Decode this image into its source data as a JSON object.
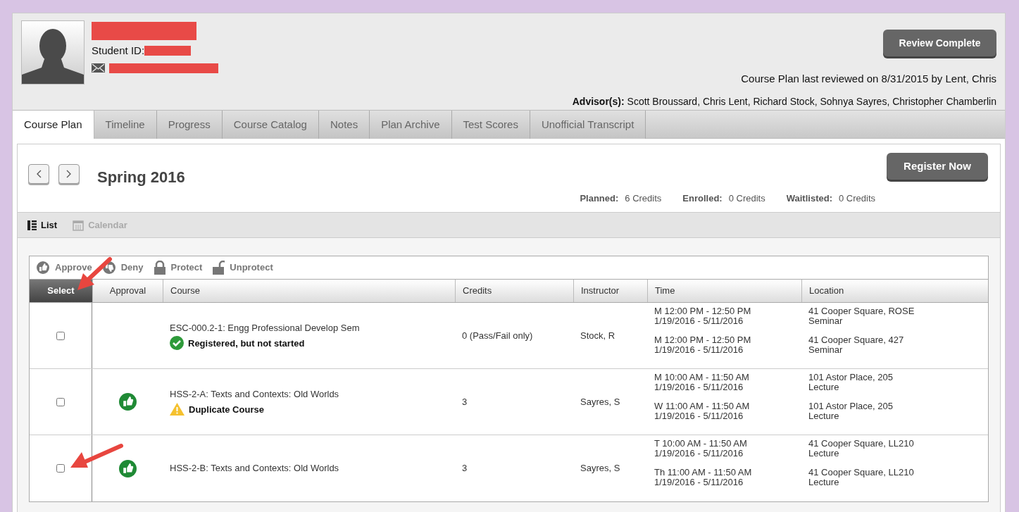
{
  "student": {
    "id_label": "Student ID:"
  },
  "header": {
    "review_button": "Review Complete",
    "last_reviewed": "Course Plan last reviewed on 8/31/2015 by Lent, Chris",
    "advisors": "**Advisor(s):** Scott Broussard, Chris Lent, Richard Stock, Sohnya Sayres, Christopher Chamberlin"
  },
  "tabs": [
    {
      "label": "Course Plan",
      "selected": true
    },
    {
      "label": "Timeline",
      "selected": false
    },
    {
      "label": "Progress",
      "selected": false
    },
    {
      "label": "Course Catalog",
      "selected": false
    },
    {
      "label": "Notes",
      "selected": false
    },
    {
      "label": "Plan Archive",
      "selected": false
    },
    {
      "label": "Test Scores",
      "selected": false
    },
    {
      "label": "Unofficial Transcript",
      "selected": false
    }
  ],
  "term": {
    "title": "Spring 2016",
    "register_button": "Register Now",
    "credits": [
      {
        "label": "Planned:",
        "value": "6 Credits"
      },
      {
        "label": "Enrolled:",
        "value": "0 Credits"
      },
      {
        "label": "Waitlisted:",
        "value": "0 Credits"
      }
    ]
  },
  "views": [
    {
      "label": "List",
      "kind": "list",
      "selected": true
    },
    {
      "label": "Calendar",
      "kind": "calendar",
      "selected": false
    }
  ],
  "actions": [
    {
      "label": "Approve",
      "kind": "approve"
    },
    {
      "label": "Deny",
      "kind": "deny"
    },
    {
      "label": "Protect",
      "kind": "protect"
    },
    {
      "label": "Unprotect",
      "kind": "unprotect"
    }
  ],
  "table": {
    "columns": [
      "Select",
      "Approval",
      "Course",
      "Credits",
      "Instructor",
      "Time",
      "Location"
    ],
    "rows": [
      {
        "checked": false,
        "approved": false,
        "course": "ESC-000.2-1: Engg Professional Develop Sem",
        "status": {
          "kind": "registered",
          "text": "Registered, but not started"
        },
        "credits": "0 (Pass/Fail only)",
        "instructor": "Stock, R",
        "meetings": [
          {
            "time": "M 12:00 PM - 12:50 PM",
            "dates": "1/19/2016 - 5/11/2016",
            "location": "41 Cooper Square, ROSE",
            "type": "Seminar"
          },
          {
            "time": "M 12:00 PM - 12:50 PM",
            "dates": "1/19/2016 - 5/11/2016",
            "location": "41 Cooper Square, 427",
            "type": "Seminar"
          }
        ]
      },
      {
        "checked": false,
        "approved": true,
        "course": "HSS-2-A: Texts and Contexts: Old Worlds",
        "status": {
          "kind": "warning",
          "text": "Duplicate Course"
        },
        "credits": "3",
        "instructor": "Sayres, S",
        "meetings": [
          {
            "time": "M 10:00 AM - 11:50 AM",
            "dates": "1/19/2016 - 5/11/2016",
            "location": "101 Astor Place, 205",
            "type": "Lecture"
          },
          {
            "time": "W 11:00 AM - 11:50 AM",
            "dates": "1/19/2016 - 5/11/2016",
            "location": "101 Astor Place, 205",
            "type": "Lecture"
          }
        ]
      },
      {
        "checked": false,
        "approved": true,
        "course": "HSS-2-B: Texts and Contexts: Old Worlds",
        "credits": "3",
        "instructor": "Sayres, S",
        "meetings": [
          {
            "time": "T 10:00 AM - 11:50 AM",
            "dates": "1/19/2016 - 5/11/2016",
            "location": "41 Cooper Square, LL210",
            "type": "Lecture"
          },
          {
            "time": "Th 11:00 AM - 11:50 AM",
            "dates": "1/19/2016 - 5/11/2016",
            "location": "41 Cooper Square, LL210",
            "type": "Lecture"
          }
        ]
      }
    ]
  }
}
